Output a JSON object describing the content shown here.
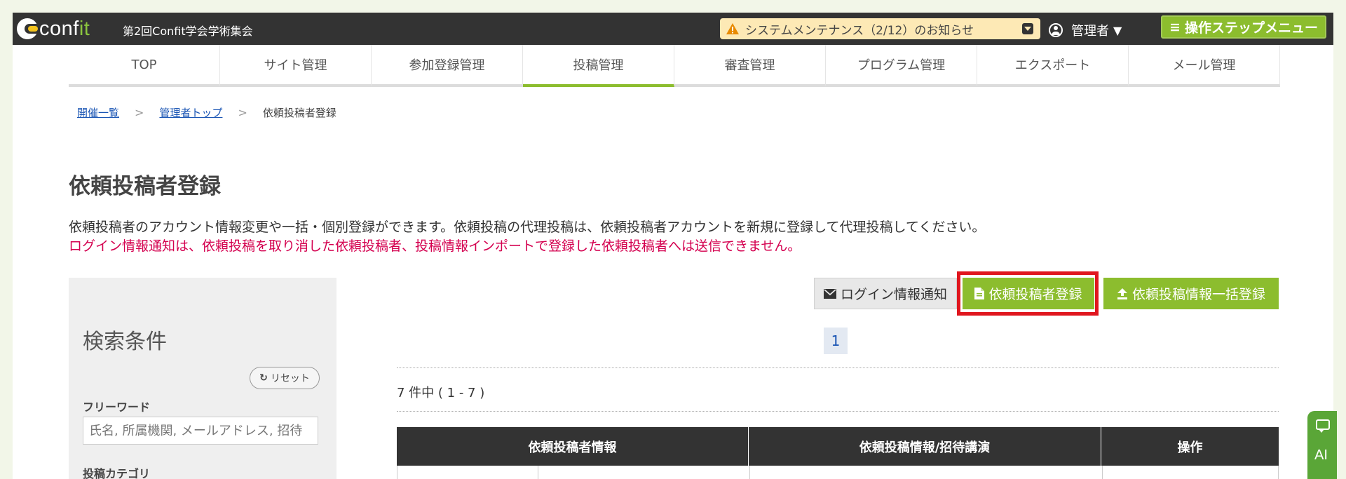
{
  "app": {
    "event_title": "第2回Confit学会学術集会",
    "logo_text_main": "conf",
    "logo_text_accent": "it",
    "maintenance_notice": "システムメンテナンス（2/12）のお知らせ",
    "user_label": "管理者",
    "user_caret": "▼",
    "step_menu_label": "操作ステップメニュー",
    "step_menu_icon": "≡"
  },
  "nav": {
    "items": [
      {
        "label": "TOP"
      },
      {
        "label": "サイト管理"
      },
      {
        "label": "参加登録管理"
      },
      {
        "label": "投稿管理"
      },
      {
        "label": "審査管理"
      },
      {
        "label": "プログラム管理"
      },
      {
        "label": "エクスポート"
      },
      {
        "label": "メール管理"
      }
    ],
    "active_index": 3
  },
  "breadcrumb": {
    "items": [
      "開催一覧",
      "管理者トップ"
    ],
    "current": "依頼投稿者登録",
    "separator": ">"
  },
  "page": {
    "title": "依頼投稿者登録",
    "description": "依頼投稿者のアカウント情報変更や一括・個別登録ができます。依頼投稿の代理投稿は、依頼投稿者アカウントを新規に登録して代理投稿してください。",
    "warning": "ログイン情報通知は、依頼投稿を取り消した依頼投稿者、投稿情報インポートで登録した依頼投稿者へは送信できません。"
  },
  "search": {
    "title": "検索条件",
    "reset_label": "リセット",
    "freeword_label": "フリーワード",
    "freeword_placeholder": "氏名, 所属機関, メールアドレス, 招待",
    "category_label": "投稿カテゴリ"
  },
  "actions": {
    "login_notice_label": "ログイン情報通知",
    "register_label": "依頼投稿者登録",
    "bulk_register_label": "依頼投稿情報一括登録"
  },
  "pagination": {
    "current_page": "1"
  },
  "results": {
    "count_text": "7 件中 ( 1 - 7 )"
  },
  "table": {
    "headers": [
      "依頼投稿者情報",
      "依頼投稿情報/招待講演",
      "操作"
    ]
  },
  "widget": {
    "label": "AI"
  },
  "colors": {
    "topbar": "#333333",
    "accent_green": "#8cbd2e",
    "warning_red": "#d4004f",
    "highlight_red": "#e0161e",
    "link_blue": "#1a55b4"
  }
}
